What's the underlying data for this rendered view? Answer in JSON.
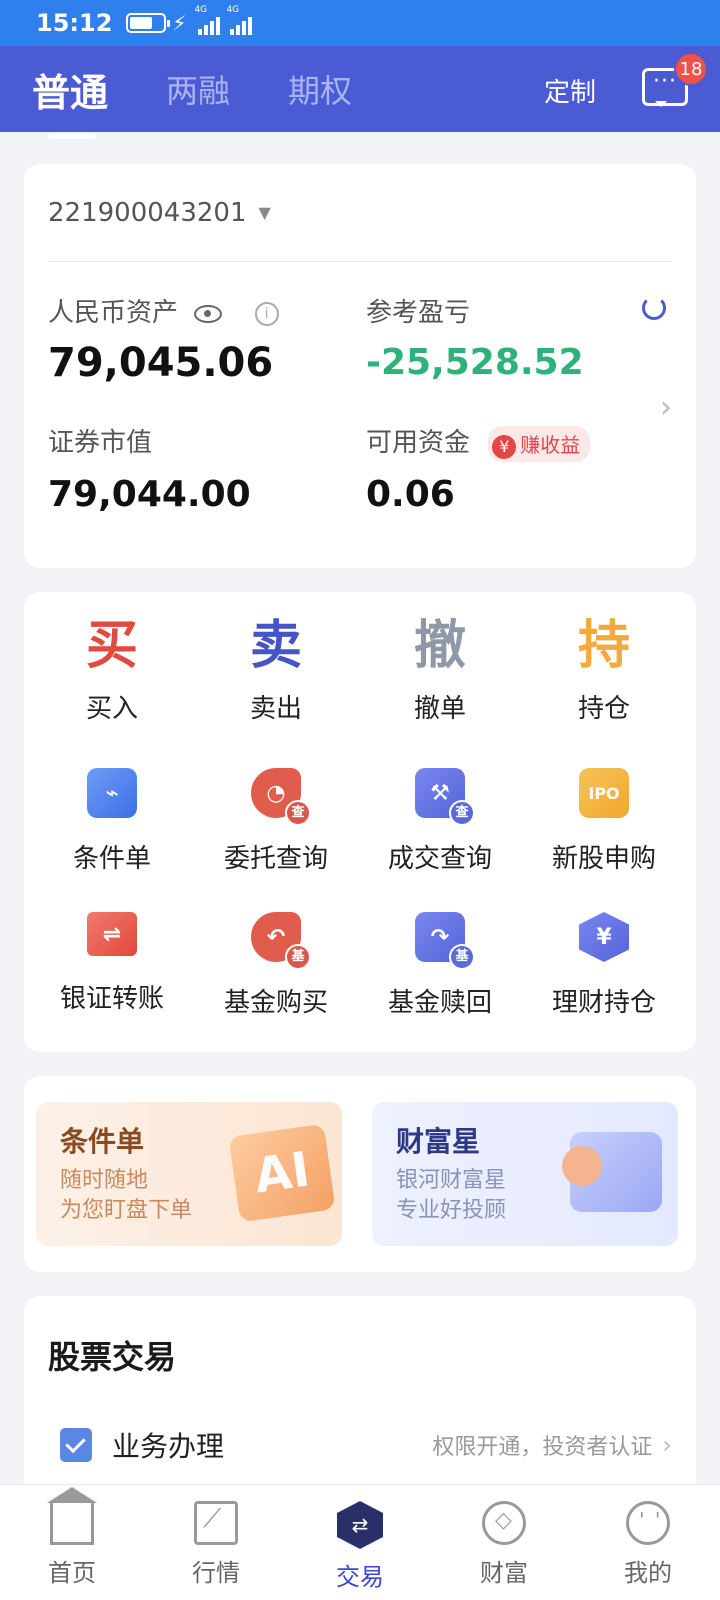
{
  "status": {
    "time": "15:12",
    "net1": "4G",
    "net2": "4G"
  },
  "header": {
    "tabs": [
      "普通",
      "两融",
      "期权"
    ],
    "custom_label": "定制",
    "message_badge": "18"
  },
  "account": {
    "id": "221900043201",
    "rmb_assets_label": "人民币资产",
    "rmb_assets_value": "79,045.06",
    "pnl_label": "参考盈亏",
    "pnl_value": "-25,528.52",
    "securities_label": "证券市值",
    "securities_value": "79,044.00",
    "available_label": "可用资金",
    "available_value": "0.06",
    "earn_tag": "赚收益",
    "earn_yen": "¥"
  },
  "actions": {
    "row1": [
      {
        "glyph": "买",
        "label": "买入",
        "color": "#e04a3f"
      },
      {
        "glyph": "卖",
        "label": "卖出",
        "color": "#4555c6"
      },
      {
        "glyph": "撤",
        "label": "撤单",
        "color": "#9097a8"
      },
      {
        "glyph": "持",
        "label": "持仓",
        "color": "#f3a93c"
      }
    ],
    "row2": [
      {
        "label": "条件单",
        "icon": "condition-order-icon"
      },
      {
        "label": "委托查询",
        "icon": "order-query-icon",
        "sub": "查"
      },
      {
        "label": "成交查询",
        "icon": "deal-query-icon",
        "sub": "查"
      },
      {
        "label": "新股申购",
        "icon": "ipo-icon",
        "text": "IPO"
      }
    ],
    "row3": [
      {
        "label": "银证转账",
        "icon": "bank-transfer-icon"
      },
      {
        "label": "基金购买",
        "icon": "fund-buy-icon",
        "sub": "基"
      },
      {
        "label": "基金赎回",
        "icon": "fund-redeem-icon",
        "sub": "基"
      },
      {
        "label": "理财持仓",
        "icon": "wealth-holding-icon",
        "text": "¥"
      }
    ]
  },
  "banners": [
    {
      "title": "条件单",
      "line1": "随时随地",
      "line2": "为您盯盘下单",
      "deco": "AI"
    },
    {
      "title": "财富星",
      "line1": "银河财富星",
      "line2": "专业好投顾"
    }
  ],
  "stocks": {
    "title": "股票交易",
    "item_label": "业务办理",
    "item_hint": "权限开通，投资者认证"
  },
  "bottom_nav": [
    "首页",
    "行情",
    "交易",
    "财富",
    "我的"
  ],
  "colors": {
    "primary": "#4a5bd4",
    "status_bar": "#2f80ed",
    "pnl_negative": "#2db37a"
  }
}
